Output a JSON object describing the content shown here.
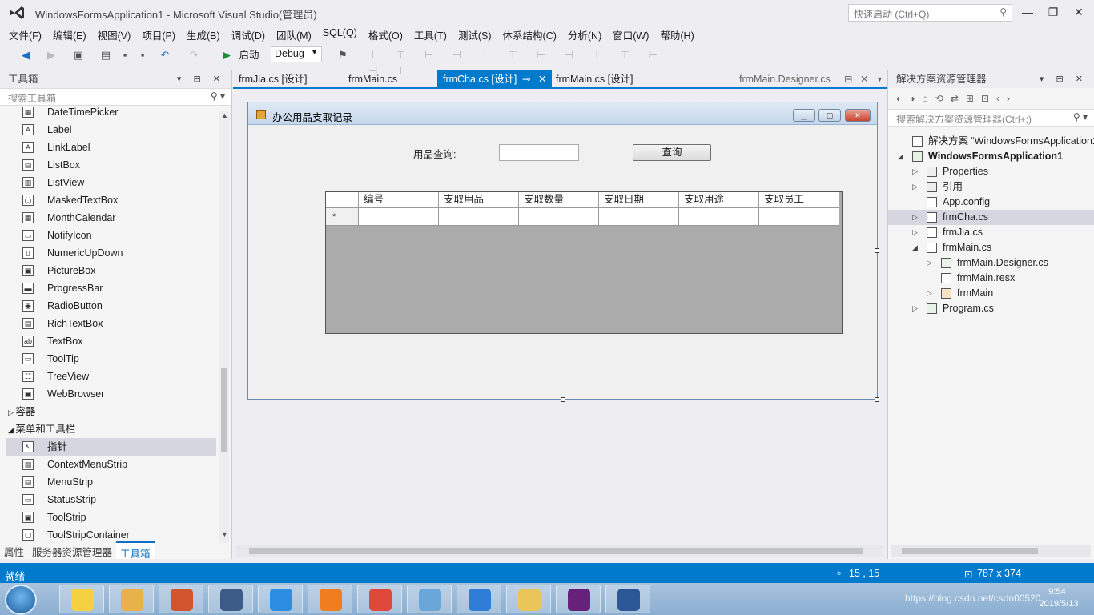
{
  "window": {
    "title": "WindowsFormsApplication1 - Microsoft Visual Studio(管理员)",
    "quick_launch_placeholder": "快速启动 (Ctrl+Q)",
    "minimize": "—",
    "maximize": "❐",
    "close": "✕"
  },
  "menu": [
    "文件(F)",
    "编辑(E)",
    "视图(V)",
    "项目(P)",
    "生成(B)",
    "调试(D)",
    "团队(M)",
    "SQL(Q)",
    "格式(O)",
    "工具(T)",
    "测试(S)",
    "体系结构(C)",
    "分析(N)",
    "窗口(W)",
    "帮助(H)"
  ],
  "toolbar": {
    "start_label": "启动",
    "config_value": "Debug"
  },
  "toolbox": {
    "title": "工具箱",
    "search_placeholder": "搜索工具箱",
    "items": [
      {
        "label": "DateTimePicker",
        "icon": "datetimepicker-icon"
      },
      {
        "label": "Label",
        "icon": "label-icon"
      },
      {
        "label": "LinkLabel",
        "icon": "linklabel-icon"
      },
      {
        "label": "ListBox",
        "icon": "listbox-icon"
      },
      {
        "label": "ListView",
        "icon": "listview-icon"
      },
      {
        "label": "MaskedTextBox",
        "icon": "maskedtextbox-icon"
      },
      {
        "label": "MonthCalendar",
        "icon": "monthcalendar-icon"
      },
      {
        "label": "NotifyIcon",
        "icon": "notifyicon-icon"
      },
      {
        "label": "NumericUpDown",
        "icon": "numericupdown-icon"
      },
      {
        "label": "PictureBox",
        "icon": "picturebox-icon"
      },
      {
        "label": "ProgressBar",
        "icon": "progressbar-icon"
      },
      {
        "label": "RadioButton",
        "icon": "radiobutton-icon"
      },
      {
        "label": "RichTextBox",
        "icon": "richtextbox-icon"
      },
      {
        "label": "TextBox",
        "icon": "textbox-icon"
      },
      {
        "label": "ToolTip",
        "icon": "tooltip-icon"
      },
      {
        "label": "TreeView",
        "icon": "treeview-icon"
      },
      {
        "label": "WebBrowser",
        "icon": "webbrowser-icon"
      }
    ],
    "group_container": "容器",
    "group_menus": "菜单和工具栏",
    "menu_items": [
      {
        "label": "指针",
        "icon": "pointer-icon"
      },
      {
        "label": "ContextMenuStrip",
        "icon": "contextmenustrip-icon"
      },
      {
        "label": "MenuStrip",
        "icon": "menustrip-icon"
      },
      {
        "label": "StatusStrip",
        "icon": "statusstrip-icon"
      },
      {
        "label": "ToolStrip",
        "icon": "toolstrip-icon"
      },
      {
        "label": "ToolStripContainer",
        "icon": "toolstripcontainer-icon"
      }
    ],
    "bottom_tabs": [
      "属性",
      "服务器资源管理器",
      "工具箱"
    ]
  },
  "doc_tabs": [
    {
      "label": "frmJia.cs [设计]"
    },
    {
      "label": "frmMain.cs"
    },
    {
      "label": "frmCha.cs [设计]",
      "active": true
    },
    {
      "label": "frmMain.cs [设计]"
    },
    {
      "label": "frmMain.Designer.cs"
    }
  ],
  "form": {
    "title": "办公用品支取记录",
    "query_label": "用品查询:",
    "query_value": "",
    "query_button": "查询",
    "grid_columns": [
      "编号",
      "支取用品",
      "支取数量",
      "支取日期",
      "支取用途",
      "支取员工"
    ],
    "new_row_marker": "*"
  },
  "solution": {
    "title": "解决方案资源管理器",
    "search_placeholder": "搜索解决方案资源管理器(Ctrl+;)",
    "items": [
      {
        "label": "解决方案 “WindowsFormsApplication1",
        "level": 0,
        "icon": "solution-icon",
        "arrow": ""
      },
      {
        "label": "WindowsFormsApplication1",
        "level": 0,
        "icon": "csharp-project-icon",
        "arrow": "◢",
        "bold": true
      },
      {
        "label": "Properties",
        "level": 1,
        "icon": "wrench-icon",
        "arrow": "▷"
      },
      {
        "label": "引用",
        "level": 1,
        "icon": "references-icon",
        "arrow": "▷"
      },
      {
        "label": "App.config",
        "level": 1,
        "icon": "config-icon",
        "arrow": ""
      },
      {
        "label": "frmCha.cs",
        "level": 1,
        "icon": "form-icon",
        "arrow": "▷",
        "selected": true
      },
      {
        "label": "frmJia.cs",
        "level": 1,
        "icon": "form-icon",
        "arrow": "▷"
      },
      {
        "label": "frmMain.cs",
        "level": 1,
        "icon": "form-icon",
        "arrow": "◢"
      },
      {
        "label": "frmMain.Designer.cs",
        "level": 2,
        "icon": "csharp-file-icon",
        "arrow": "▷"
      },
      {
        "label": "frmMain.resx",
        "level": 2,
        "icon": "resx-icon",
        "arrow": ""
      },
      {
        "label": "frmMain",
        "level": 2,
        "icon": "class-icon",
        "arrow": "▷"
      },
      {
        "label": "Program.cs",
        "level": 1,
        "icon": "csharp-file-icon",
        "arrow": "▷"
      }
    ]
  },
  "status": {
    "state": "就绪",
    "position": "15 , 15",
    "size": "787 x 374"
  },
  "taskbar": {
    "clock_time": "9:54",
    "clock_date": "2019/5/13",
    "watermark": "https://blog.csdn.net/csdn00520",
    "apps": [
      {
        "name": "qq-icon",
        "color": "#f5d041"
      },
      {
        "name": "paint-tools-icon",
        "color": "#e8b14a"
      },
      {
        "name": "powerpoint-icon",
        "color": "#d2542c"
      },
      {
        "name": "sublime-icon",
        "color": "#3c5b86"
      },
      {
        "name": "ie-icon",
        "color": "#2d8de0"
      },
      {
        "name": "xampp-icon",
        "color": "#f07e21"
      },
      {
        "name": "chrome-icon",
        "color": "#e0483c"
      },
      {
        "name": "paint-icon",
        "color": "#6aa7d8"
      },
      {
        "name": "browser-icon",
        "color": "#2f7dd6"
      },
      {
        "name": "explorer-icon",
        "color": "#e9c55a"
      },
      {
        "name": "visual-studio-icon",
        "color": "#68217a"
      },
      {
        "name": "word-icon",
        "color": "#2b5797"
      }
    ]
  }
}
